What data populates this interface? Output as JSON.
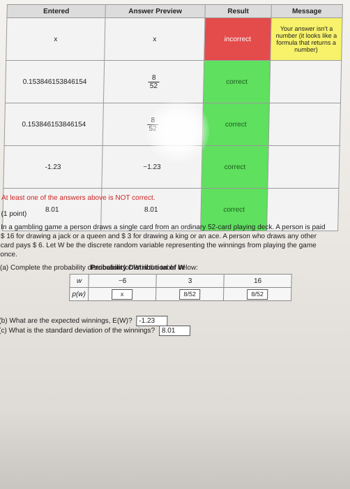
{
  "results_table": {
    "headers": [
      "Entered",
      "Answer Preview",
      "Result",
      "Message"
    ],
    "rows": [
      {
        "entered": "x",
        "preview": "x",
        "result": "incorrect",
        "message": "Your answer isn't a number (it looks like a formula that returns a number)"
      },
      {
        "entered": "0.153846153846154",
        "preview_num": "8",
        "preview_den": "52",
        "result": "correct",
        "message": ""
      },
      {
        "entered": "0.153846153846154",
        "preview_num": "8",
        "preview_den": "52",
        "result": "correct",
        "message": ""
      },
      {
        "entered": "-1.23",
        "preview": "−1.23",
        "result": "correct",
        "message": ""
      },
      {
        "entered": "8.01",
        "preview": "8.01",
        "result": "correct",
        "message": ""
      }
    ]
  },
  "warning": "At least one of the answers above is NOT correct.",
  "problem": {
    "points": "(1 point)",
    "statement": "In a gambling game a person draws a single card from an ordinary 52-card playing deck. A person is paid $ 16 for drawing a jack or a queen and $ 3 for drawing a king or an ace. A person who draws any other card pays $ 6. Let W be the discrete random variable representing the winnings from playing the game once.",
    "part_a": "(a) Complete the probability distribution for W in the table below:",
    "dist_title": "Probability Distribution of W",
    "w_label": "w",
    "p_label": "p(w)",
    "w_values": [
      "−6",
      "3",
      "16"
    ],
    "p_values": [
      "x",
      "8/52",
      "8/52"
    ],
    "part_b": "(b) What are the expected winnings, E(W)?",
    "part_b_answer": "-1.23",
    "part_c": "(c) What is the standard deviation of the winnings?",
    "part_c_answer": "8.01"
  }
}
